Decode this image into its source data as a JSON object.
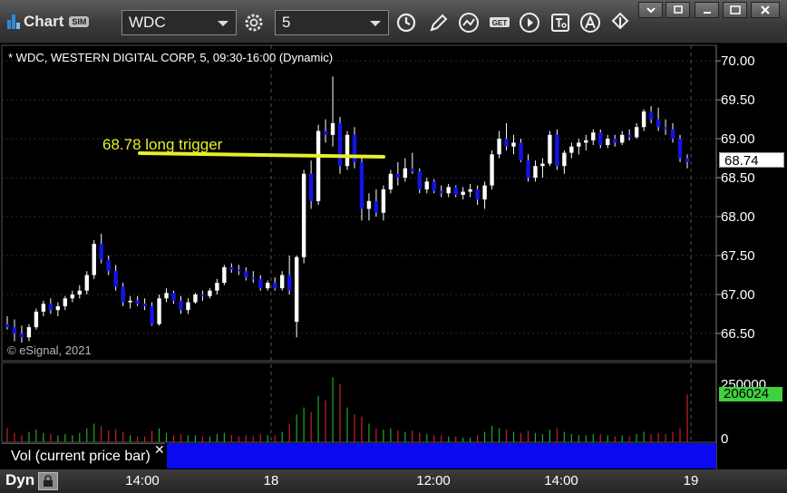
{
  "toolbar": {
    "title": "Chart",
    "sim_badge": "SIM",
    "symbol": "WDC",
    "interval": "5"
  },
  "chart": {
    "header": "* WDC, WESTERN DIGITAL CORP, 5, 09:30-16:00 (Dynamic)",
    "copyright": "© eSignal, 2021",
    "annotation": "68.78 long trigger",
    "last_price": "68.74",
    "last_volume": "206024",
    "volume_study_label": "Vol (current price bar)",
    "volume_axis_top": "250000",
    "volume_axis_zero": "0"
  },
  "bottom": {
    "mode": "Dyn",
    "x_ticks": [
      "14:00",
      "18",
      "12:00",
      "14:00",
      "19"
    ]
  },
  "colors": {
    "up_candle": "#ffffff",
    "down_candle": "#1414e6",
    "trigger_line": "#e6ef2a",
    "volume_up": "#22aa22",
    "volume_down": "#cc2222"
  },
  "chart_data": {
    "type": "candlestick",
    "y_ticks": [
      70.0,
      69.5,
      69.0,
      68.5,
      68.0,
      67.5,
      67.0,
      66.5
    ],
    "ylim": [
      66.15,
      70.2
    ],
    "trigger_level": 68.78,
    "volume_ylim": [
      0,
      320000
    ],
    "bars": [
      [
        66.62,
        66.72,
        66.55,
        66.58,
        60000
      ],
      [
        66.58,
        66.68,
        66.4,
        66.5,
        40000
      ],
      [
        66.5,
        66.6,
        66.38,
        66.45,
        30000
      ],
      [
        66.45,
        66.62,
        66.4,
        66.58,
        45000
      ],
      [
        66.58,
        66.82,
        66.55,
        66.78,
        55000
      ],
      [
        66.78,
        66.92,
        66.72,
        66.88,
        40000
      ],
      [
        66.88,
        66.95,
        66.75,
        66.8,
        35000
      ],
      [
        66.8,
        66.9,
        66.72,
        66.85,
        30000
      ],
      [
        66.85,
        66.98,
        66.8,
        66.95,
        35000
      ],
      [
        66.95,
        67.05,
        66.9,
        67.0,
        30000
      ],
      [
        67.0,
        67.12,
        66.95,
        67.05,
        40000
      ],
      [
        67.05,
        67.3,
        67.0,
        67.25,
        60000
      ],
      [
        67.25,
        67.7,
        67.2,
        67.65,
        80000
      ],
      [
        67.65,
        67.78,
        67.4,
        67.45,
        70000
      ],
      [
        67.45,
        67.5,
        67.25,
        67.3,
        50000
      ],
      [
        67.3,
        67.38,
        67.05,
        67.1,
        55000
      ],
      [
        67.1,
        67.15,
        66.85,
        66.9,
        45000
      ],
      [
        66.9,
        66.98,
        66.82,
        66.92,
        30000
      ],
      [
        66.92,
        66.98,
        66.85,
        66.88,
        25000
      ],
      [
        66.88,
        66.95,
        66.8,
        66.85,
        25000
      ],
      [
        66.85,
        66.9,
        66.6,
        66.62,
        50000
      ],
      [
        66.62,
        67.0,
        66.6,
        66.95,
        60000
      ],
      [
        66.95,
        67.08,
        66.9,
        67.02,
        40000
      ],
      [
        67.02,
        67.05,
        66.88,
        66.92,
        30000
      ],
      [
        66.92,
        66.98,
        66.75,
        66.8,
        35000
      ],
      [
        66.8,
        66.95,
        66.75,
        66.9,
        30000
      ],
      [
        66.9,
        67.02,
        66.88,
        67.0,
        30000
      ],
      [
        67.0,
        67.05,
        66.92,
        66.98,
        25000
      ],
      [
        66.98,
        67.08,
        66.95,
        67.05,
        25000
      ],
      [
        67.05,
        67.2,
        67.0,
        67.15,
        35000
      ],
      [
        67.15,
        67.38,
        67.12,
        67.35,
        40000
      ],
      [
        67.35,
        67.4,
        67.28,
        67.32,
        30000
      ],
      [
        67.32,
        67.38,
        67.25,
        67.3,
        25000
      ],
      [
        67.3,
        67.35,
        67.18,
        67.22,
        30000
      ],
      [
        67.22,
        67.3,
        67.15,
        67.2,
        25000
      ],
      [
        67.2,
        67.25,
        67.05,
        67.08,
        35000
      ],
      [
        67.08,
        67.18,
        67.05,
        67.15,
        30000
      ],
      [
        67.15,
        67.22,
        67.05,
        67.08,
        30000
      ],
      [
        67.08,
        67.3,
        67.05,
        67.25,
        45000
      ],
      [
        67.25,
        67.5,
        67.0,
        67.05,
        80000
      ],
      [
        66.65,
        67.5,
        66.45,
        67.48,
        120000
      ],
      [
        67.48,
        68.6,
        67.4,
        68.55,
        150000
      ],
      [
        68.55,
        68.72,
        68.1,
        68.2,
        130000
      ],
      [
        68.2,
        69.18,
        68.15,
        69.1,
        200000
      ],
      [
        69.1,
        69.25,
        68.95,
        69.05,
        180000
      ],
      [
        69.05,
        69.8,
        68.9,
        69.2,
        280000
      ],
      [
        69.2,
        69.28,
        68.55,
        68.65,
        250000
      ],
      [
        68.65,
        69.1,
        68.6,
        69.05,
        150000
      ],
      [
        69.05,
        69.15,
        68.62,
        68.7,
        120000
      ],
      [
        68.7,
        68.75,
        67.95,
        68.1,
        110000
      ],
      [
        68.1,
        68.3,
        67.95,
        68.2,
        80000
      ],
      [
        68.2,
        68.35,
        68.0,
        68.05,
        60000
      ],
      [
        68.05,
        68.4,
        67.95,
        68.35,
        55000
      ],
      [
        68.35,
        68.6,
        68.3,
        68.55,
        60000
      ],
      [
        68.55,
        68.7,
        68.4,
        68.5,
        50000
      ],
      [
        68.5,
        68.75,
        68.45,
        68.62,
        45000
      ],
      [
        68.62,
        68.82,
        68.55,
        68.58,
        50000
      ],
      [
        68.58,
        68.62,
        68.3,
        68.35,
        40000
      ],
      [
        68.35,
        68.5,
        68.3,
        68.45,
        35000
      ],
      [
        68.45,
        68.48,
        68.3,
        68.33,
        30000
      ],
      [
        68.33,
        68.4,
        68.25,
        68.3,
        30000
      ],
      [
        68.3,
        68.42,
        68.25,
        68.38,
        25000
      ],
      [
        68.38,
        68.4,
        68.25,
        68.28,
        25000
      ],
      [
        68.28,
        68.38,
        68.22,
        68.32,
        20000
      ],
      [
        68.32,
        68.42,
        68.25,
        68.35,
        20000
      ],
      [
        68.35,
        68.4,
        68.15,
        68.22,
        30000
      ],
      [
        68.22,
        68.45,
        68.1,
        68.4,
        45000
      ],
      [
        68.4,
        68.85,
        68.35,
        68.8,
        70000
      ],
      [
        68.8,
        69.1,
        68.75,
        69.0,
        60000
      ],
      [
        69.0,
        69.2,
        68.85,
        68.9,
        55000
      ],
      [
        68.9,
        69.05,
        68.8,
        68.95,
        45000
      ],
      [
        68.95,
        69.0,
        68.7,
        68.72,
        40000
      ],
      [
        68.72,
        68.8,
        68.45,
        68.5,
        50000
      ],
      [
        68.5,
        68.72,
        68.45,
        68.65,
        40000
      ],
      [
        68.65,
        68.75,
        68.5,
        68.68,
        35000
      ],
      [
        68.68,
        69.1,
        68.65,
        69.05,
        55000
      ],
      [
        69.05,
        69.12,
        68.6,
        68.65,
        60000
      ],
      [
        68.65,
        68.85,
        68.55,
        68.82,
        45000
      ],
      [
        68.82,
        68.95,
        68.75,
        68.9,
        35000
      ],
      [
        68.9,
        69.0,
        68.8,
        68.95,
        30000
      ],
      [
        68.95,
        69.05,
        68.85,
        68.98,
        30000
      ],
      [
        68.98,
        69.12,
        68.92,
        69.08,
        35000
      ],
      [
        69.08,
        69.12,
        68.88,
        68.92,
        35000
      ],
      [
        68.92,
        69.05,
        68.88,
        69.0,
        30000
      ],
      [
        69.0,
        69.05,
        68.9,
        68.95,
        25000
      ],
      [
        68.95,
        69.1,
        68.92,
        69.05,
        30000
      ],
      [
        69.05,
        69.12,
        68.98,
        69.02,
        25000
      ],
      [
        69.02,
        69.2,
        69.0,
        69.15,
        35000
      ],
      [
        69.15,
        69.38,
        69.1,
        69.35,
        45000
      ],
      [
        69.35,
        69.42,
        69.2,
        69.25,
        35000
      ],
      [
        69.25,
        69.4,
        69.1,
        69.15,
        40000
      ],
      [
        69.15,
        69.25,
        69.05,
        69.12,
        35000
      ],
      [
        69.12,
        69.2,
        68.95,
        69.0,
        45000
      ],
      [
        69.0,
        69.05,
        68.7,
        68.75,
        60000
      ],
      [
        68.75,
        68.8,
        68.62,
        68.7,
        206024
      ]
    ]
  }
}
